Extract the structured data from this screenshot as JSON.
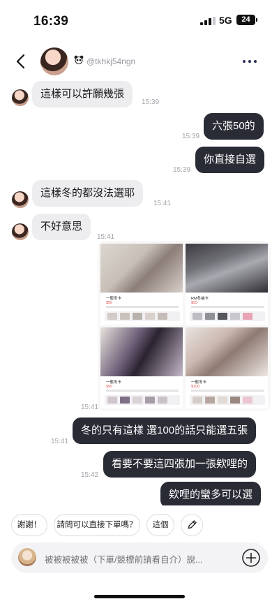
{
  "status_bar": {
    "time": "16:39",
    "network": "5G",
    "battery": "24"
  },
  "header": {
    "handle": "@tkhkj54ngn"
  },
  "messages": [
    {
      "text": "這樣可以許願幾張",
      "time": "15:39"
    },
    {
      "text": "六張50的",
      "time": "15:39"
    },
    {
      "text": "你直接自選",
      "time": "15:39"
    },
    {
      "text": "這樣冬的都沒法選耶",
      "time": "15:41"
    },
    {
      "text": "不好意思",
      "time": "15:41"
    },
    {
      "text": "",
      "time": "15:41"
    },
    {
      "text": "冬的只有這樣 選100的話只能選五張",
      "time": "15:41"
    },
    {
      "text": "看要不要這四張加一張欸哩的",
      "time": "15:42"
    },
    {
      "text": "欸哩的蠻多可以選",
      "time": ""
    }
  ],
  "collage": {
    "cards": [
      {
        "title": "一般冬卡",
        "price": "$50"
      },
      {
        "title": "RM冬袖卡",
        "price": "$55"
      },
      {
        "title": "一般冬卡",
        "price": "$50"
      },
      {
        "title": "一般冬卡",
        "price": "$100"
      }
    ]
  },
  "quick_replies": [
    "謝謝！",
    "請問可以直接下單嗎？",
    "這個"
  ],
  "composer": {
    "placeholder": "被被被被被（下單/競標前請看自介）說..."
  },
  "icons": {
    "back": "chevron-left-icon",
    "badge": "panda-icon",
    "more": "more-dots-icon",
    "edit": "pencil-icon",
    "add": "plus-circle-icon"
  },
  "colors": {
    "incoming_bubble": "#ededf0",
    "outgoing_bubble": "#2a2c35",
    "timestamp": "#a3a3ab"
  }
}
